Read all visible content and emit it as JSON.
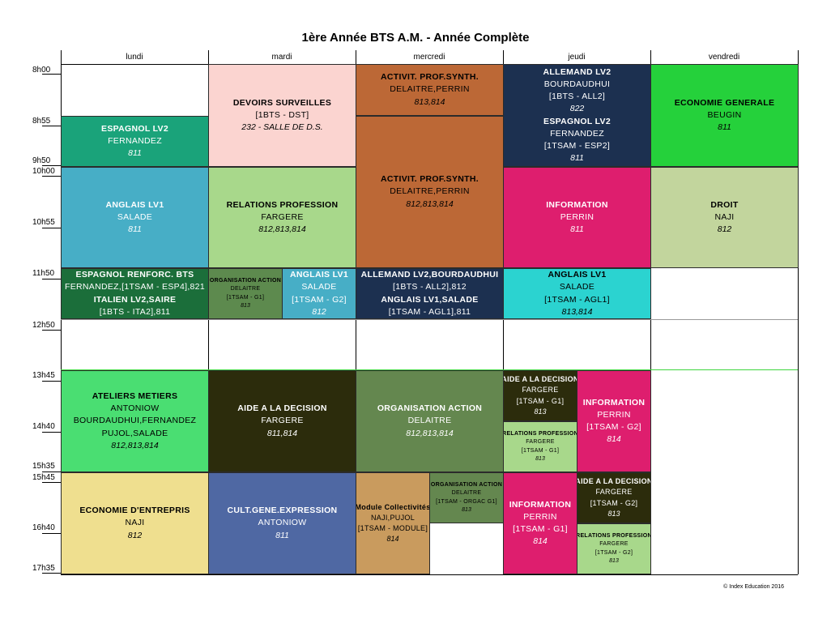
{
  "title": "1ère Année BTS A.M. - Année Complète",
  "days": [
    "lundi",
    "mardi",
    "mercredi",
    "jeudi",
    "vendredi"
  ],
  "times": [
    "8h00",
    "8h55",
    "9h50",
    "10h00",
    "10h55",
    "11h50",
    "12h50",
    "13h45",
    "14h40",
    "15h35",
    "15h45",
    "16h40",
    "17h35"
  ],
  "copyright": "© Index Education 2016",
  "cells": {
    "lun_espagnol": {
      "t": "ESPAGNOL LV2",
      "s": "FERNANDEZ",
      "r": "811",
      "color": "#1aa37a"
    },
    "lun_anglais": {
      "t": "ANGLAIS LV1",
      "s": "SALADE",
      "r": "811",
      "color": "#47aec6"
    },
    "lun_espagnol_renf": {
      "t": "ESPAGNOL RENFORC. BTS",
      "s": "FERNANDEZ,[1TSAM - ESP4],821",
      "t2": "ITALIEN LV2,SAIRE",
      "s2": "[1BTS - ITA2],811",
      "color": "#1b6e3a"
    },
    "lun_ateliers": {
      "t": "ATELIERS METIERS",
      "s": "ANTONIOW",
      "s2": "BOURDAUDHUI,FERNANDEZ",
      "s3": "PUJOL,SALADE",
      "r": "812,813,814",
      "color": "#4ade72"
    },
    "lun_economie": {
      "t": "ECONOMIE D'ENTREPRIS",
      "s": "NAJI",
      "r": "812",
      "color": "#efdf8f"
    },
    "mar_devoirs": {
      "t": "DEVOIRS SURVEILLES",
      "s": "[1BTS - DST]",
      "r": "232 - SALLE DE D.S.",
      "color": "#fbd4d0"
    },
    "mar_relations": {
      "t": "RELATIONS PROFESSION",
      "s": "FARGERE",
      "r": "812,813,814",
      "color": "#a8d88b"
    },
    "mar_organisation": {
      "t": "ORGANISATION ACTION",
      "s": "DELAITRE",
      "s2": "[1TSAM - G1]",
      "r": "813",
      "color": "#5d8a4e"
    },
    "mar_anglais": {
      "t": "ANGLAIS LV1",
      "s": "SALADE",
      "s2": "[1TSAM - G2]",
      "r": "812",
      "color": "#47aec6"
    },
    "mar_aide": {
      "t": "AIDE A LA DECISION",
      "s": "FARGERE",
      "r": "811,814",
      "color": "#2c2c0c"
    },
    "mar_cultgene": {
      "t": "CULT.GENE.EXPRESSION",
      "s": "ANTONIOW",
      "r": "811",
      "color": "#4f68a3"
    },
    "mer_activit1": {
      "t": "ACTIVIT. PROF.SYNTH.",
      "s": "DELAITRE,PERRIN",
      "r": "813,814",
      "color": "#bc6836"
    },
    "mer_activit2": {
      "t": "ACTIVIT. PROF.SYNTH.",
      "s": "DELAITRE,PERRIN",
      "r": "812,813,814",
      "color": "#bc6836"
    },
    "mer_allemand": {
      "t": "ALLEMAND LV2,BOURDAUDHUI",
      "s": "[1BTS - ALL2],812",
      "t2": "ANGLAIS LV1,SALADE",
      "s2": "[1TSAM - AGL1],811",
      "color": "#1c3050"
    },
    "mer_organisation": {
      "t": "ORGANISATION ACTION",
      "s": "DELAITRE",
      "r": "812,813,814",
      "color": "#64874f"
    },
    "mer_module": {
      "t": "Module Collectivités",
      "s": "NAJI,PUJOL",
      "s2": "[1TSAM - MODULE]",
      "r": "814",
      "color": "#c99b5e"
    },
    "mer_organisation2": {
      "t": "ORGANISATION ACTION",
      "s": "DELAITRE",
      "s2": "[1TSAM - ORGAC G1]",
      "r": "813",
      "color": "#64874f"
    },
    "jeu_allemand": {
      "t": "ALLEMAND LV2",
      "s": "BOURDAUDHUI",
      "s2": "[1BTS - ALL2]",
      "r": "822",
      "t2": "ESPAGNOL LV2",
      "s3": "FERNANDEZ",
      "s4": "[1TSAM - ESP2]",
      "r2": "811",
      "color": "#1c3050"
    },
    "jeu_information": {
      "t": "INFORMATION",
      "s": "PERRIN",
      "r": "811",
      "color": "#de1e6e"
    },
    "jeu_anglais": {
      "t": "ANGLAIS LV1",
      "s": "SALADE",
      "s2": "[1TSAM - AGL1]",
      "r": "813,814",
      "color": "#2bd3d0"
    },
    "jeu_aide1": {
      "t": "AIDE A LA DECISION",
      "s": "FARGERE",
      "s2": "[1TSAM - G1]",
      "r": "813",
      "color": "#2c2c0c"
    },
    "jeu_relations1": {
      "t": "RELATIONS PROFESSION",
      "s": "FARGERE",
      "s2": "[1TSAM - G1]",
      "r": "813",
      "color": "#a8d88b"
    },
    "jeu_information2": {
      "t": "INFORMATION",
      "s": "PERRIN",
      "s2": "[1TSAM - G2]",
      "r": "814",
      "color": "#de1e6e"
    },
    "jeu_information3": {
      "t": "INFORMATION",
      "s": "PERRIN",
      "s2": "[1TSAM - G1]",
      "r": "814",
      "color": "#de1e6e"
    },
    "jeu_aide2": {
      "t": "AIDE A LA DECISION",
      "s": "FARGERE",
      "s2": "[1TSAM - G2]",
      "r": "813",
      "color": "#2c2c0c"
    },
    "jeu_relations2": {
      "t": "RELATIONS PROFESSION",
      "s": "FARGERE",
      "s2": "[1TSAM - G2]",
      "r": "813",
      "color": "#a8d88b"
    },
    "ven_economie": {
      "t": "ECONOMIE GENERALE",
      "s": "BEUGIN",
      "r": "811",
      "color": "#25d13b"
    },
    "ven_droit": {
      "t": "DROIT",
      "s": "NAJI",
      "r": "812",
      "color": "#c2d59d"
    }
  }
}
